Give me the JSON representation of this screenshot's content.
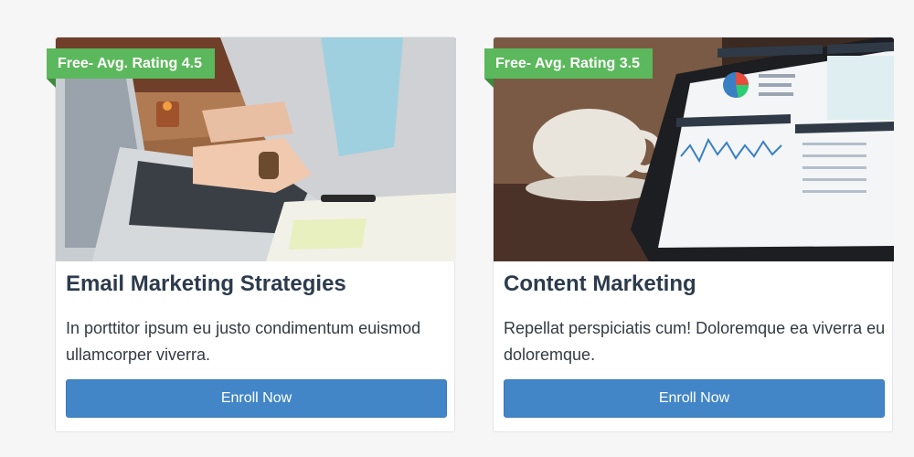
{
  "courses": [
    {
      "badge": "Free- Avg. Rating 4.5",
      "title": "Email Marketing Strategies",
      "description": "In porttitor ipsum eu justo condimentum euismod ullamcorper viverra.",
      "button_label": "Enroll Now"
    },
    {
      "badge": "Free- Avg. Rating 3.5",
      "title": "Content Marketing",
      "description": "Repellat perspiciatis cum! Doloremque ea viverra eu doloremque.",
      "button_label": "Enroll Now"
    }
  ],
  "colors": {
    "badge_bg": "#5cb85c",
    "button_bg": "#4286c8",
    "title_text": "#2c3b4d",
    "page_bg": "#f6f6f7"
  }
}
